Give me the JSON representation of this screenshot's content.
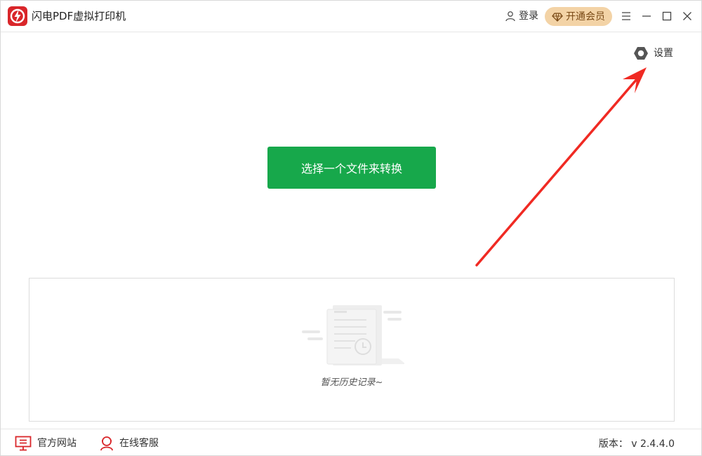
{
  "app": {
    "title": "闪电PDF虚拟打印机",
    "logo_icon": "lightning-pdf-logo",
    "brand_color": "#d9262a"
  },
  "header": {
    "login_label": "登录",
    "vip_label": "开通会员",
    "vip_color": "#f3d3a6",
    "menu_icon": "menu-icon",
    "minimize_icon": "minimize-icon",
    "maximize_icon": "maximize-icon",
    "close_icon": "close-icon"
  },
  "settings": {
    "label": "设置",
    "icon": "gear-icon"
  },
  "main": {
    "convert_button_label": "选择一个文件来转换",
    "accent_color": "#17a84b"
  },
  "history": {
    "empty_text": "暂无历史记录~",
    "illustration_icon": "empty-document-clock-icon"
  },
  "footer": {
    "website_label": "官方网站",
    "support_label": "在线客服",
    "version_text": "版本： v 2.4.4.0"
  },
  "annotation": {
    "arrow_color": "#f02a23"
  }
}
